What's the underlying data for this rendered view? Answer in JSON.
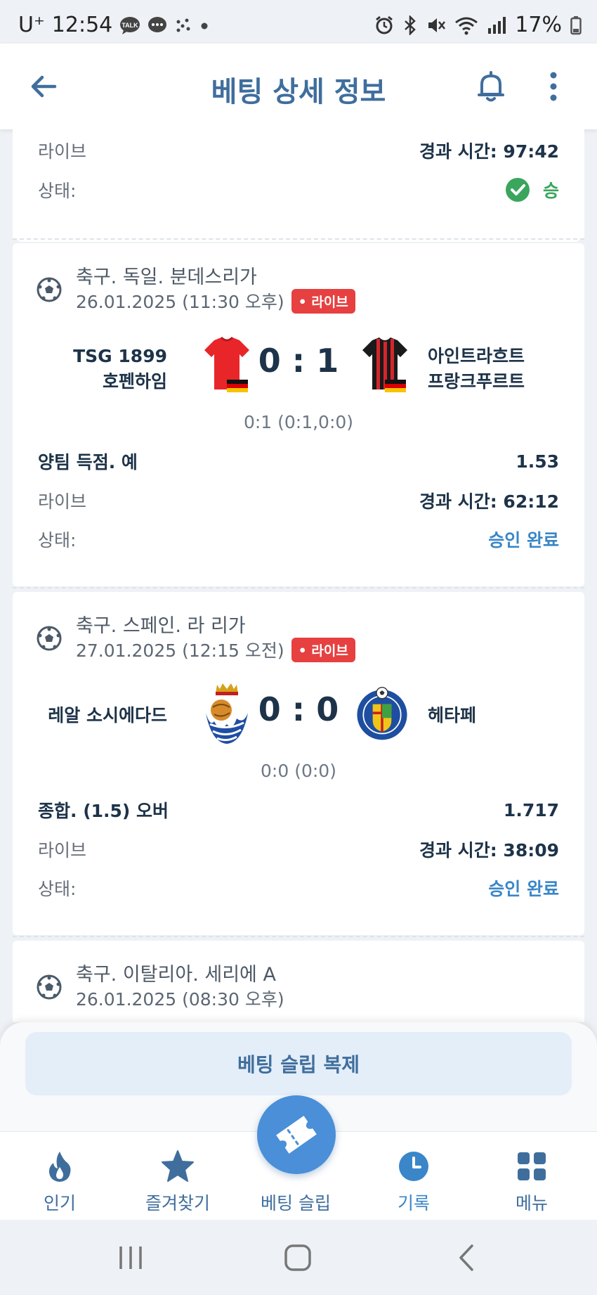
{
  "status_bar": {
    "carrier": "U⁺",
    "time": "12:54",
    "battery": "17%",
    "left_icons": [
      "talk-icon",
      "message-icon",
      "sparkle-icon",
      "dot-icon"
    ],
    "right_icons": [
      "alarm-icon",
      "bluetooth-icon",
      "mute-icon",
      "wifi-icon",
      "signal-icon",
      "battery-icon"
    ]
  },
  "header": {
    "title": "베팅 상세 정보",
    "icons": [
      "back-arrow-icon",
      "bell-icon",
      "more-vert-icon"
    ]
  },
  "cards": [
    {
      "partial": true,
      "rows": [
        {
          "label": "라이브",
          "value": "경과 시간: 97:42"
        },
        {
          "label": "상태:",
          "value": "승",
          "status_type": "win"
        }
      ]
    },
    {
      "league": "축구. 독일. 분데스리가",
      "datetime": "26.01.2025 (11:30 오후)",
      "live_badge": "• 라이브",
      "home_team_line1": "TSG 1899",
      "home_team_line2": "호펜하임",
      "away_team_line1": "아인트라흐트",
      "away_team_line2": "프랑크푸르트",
      "score": "0 : 1",
      "sub_score": "0:1 (0:1,0:0)",
      "bet": "양팀 득점. 예",
      "odds": "1.53",
      "live_label": "라이브",
      "elapsed": "경과 시간: 62:12",
      "status_label": "상태:",
      "status": "승인 완료"
    },
    {
      "league": "축구. 스페인. 라 리가",
      "datetime": "27.01.2025 (12:15 오전)",
      "live_badge": "• 라이브",
      "home_team_line1": "레알 소시에다드",
      "away_team_line1": "헤타페",
      "score": "0 : 0",
      "sub_score": "0:0 (0:0)",
      "bet": "종합. (1.5) 오버",
      "odds": "1.717",
      "live_label": "라이브",
      "elapsed": "경과 시간: 38:09",
      "status_label": "상태:",
      "status": "승인 완료"
    },
    {
      "partial": true,
      "league": "축구. 이탈리아. 세리에 A",
      "datetime": "26.01.2025 (08:30 오후)"
    }
  ],
  "copy_button": "베팅 슬립 복제",
  "bottom_nav": [
    {
      "label": "인기",
      "icon": "flame-icon"
    },
    {
      "label": "즐겨찾기",
      "icon": "star-icon"
    },
    {
      "label": "베팅 슬립",
      "icon": "ticket-icon"
    },
    {
      "label": "기록",
      "icon": "clock-icon",
      "active": true
    },
    {
      "label": "메뉴",
      "icon": "grid-icon"
    }
  ],
  "colors": {
    "accent": "#3f6e9d",
    "active": "#3a86c8",
    "live": "#e64040",
    "win": "#3aa55c",
    "fab": "#4a8fd8"
  }
}
